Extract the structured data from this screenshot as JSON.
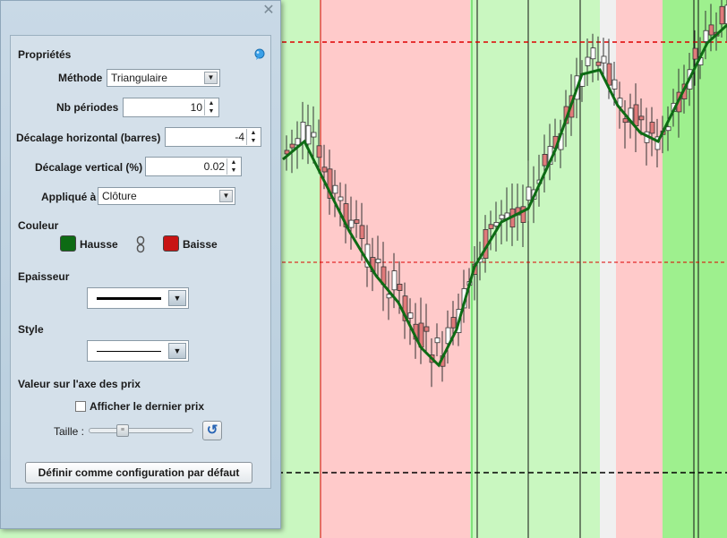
{
  "dialog": {
    "close_icon": "close-icon",
    "section_title": "Propriétés",
    "method": {
      "label": "Méthode",
      "value": "Triangulaire"
    },
    "periods": {
      "label": "Nb périodes",
      "value": "10"
    },
    "h_shift": {
      "label": "Décalage horizontal (barres)",
      "value": "-4"
    },
    "v_shift": {
      "label": "Décalage vertical (%)",
      "value": "0.02"
    },
    "applied": {
      "label": "Appliqué à",
      "value": "Clôture"
    },
    "color": {
      "label": "Couleur",
      "up_label": "Hausse",
      "up_color": "#0d6b14",
      "down_label": "Baisse",
      "down_color": "#c81414",
      "link_icon": "chain-link-icon"
    },
    "thickness_label": "Epaisseur",
    "style_label": "Style",
    "price_axis_label": "Valeur sur l'axe des prix",
    "last_price": {
      "label": "Afficher le dernier prix",
      "checked": false
    },
    "size": {
      "label": "Taille :",
      "level": 0.3,
      "reset_icon": "reset-icon"
    },
    "default_button": "Définir comme configuration par défaut"
  },
  "chart": {
    "up_color": "#0d6b14",
    "down_color": "#c81414",
    "zone_up_color": "#c9f7c0",
    "zone_down_color": "#ffcaca"
  }
}
